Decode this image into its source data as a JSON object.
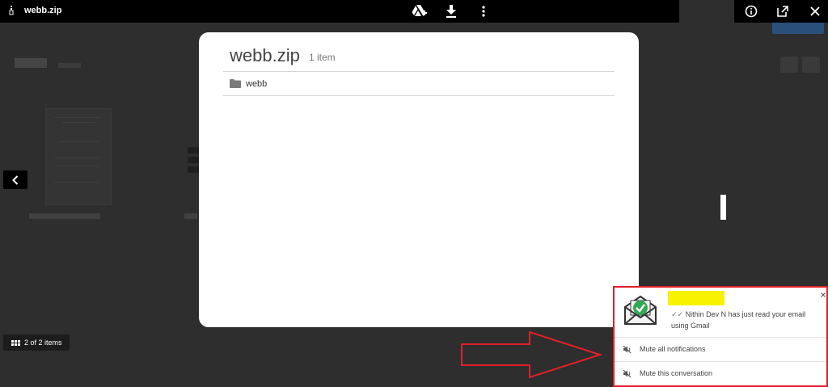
{
  "viewer": {
    "file_name": "webb.zip",
    "item_counter": "2 of 2 items"
  },
  "archive": {
    "title": "webb.zip",
    "count": "1 item",
    "entries": [
      {
        "name": "webb",
        "type": "folder"
      }
    ]
  },
  "notification": {
    "ticks": "✓✓",
    "message": "Nithin Dev N has just read your email using Gmail",
    "actions": [
      {
        "label": "Mute all notifications"
      },
      {
        "label": "Mute this conversation"
      }
    ]
  },
  "colors": {
    "topbar": "#000000",
    "overlay": "#2e2e2e",
    "notification_border": "#e0202a",
    "highlight": "#f7f300",
    "check_green": "#34a853"
  },
  "icons": {
    "topbar": [
      "add-to-drive-icon",
      "download-icon",
      "more-vert-icon",
      "info-icon",
      "open-in-new-icon",
      "close-icon"
    ],
    "nav": [
      "chevron-left-icon",
      "grid-icon"
    ],
    "entry": "folder-icon",
    "notification": [
      "email-read-check-icon",
      "mute-icon"
    ]
  }
}
